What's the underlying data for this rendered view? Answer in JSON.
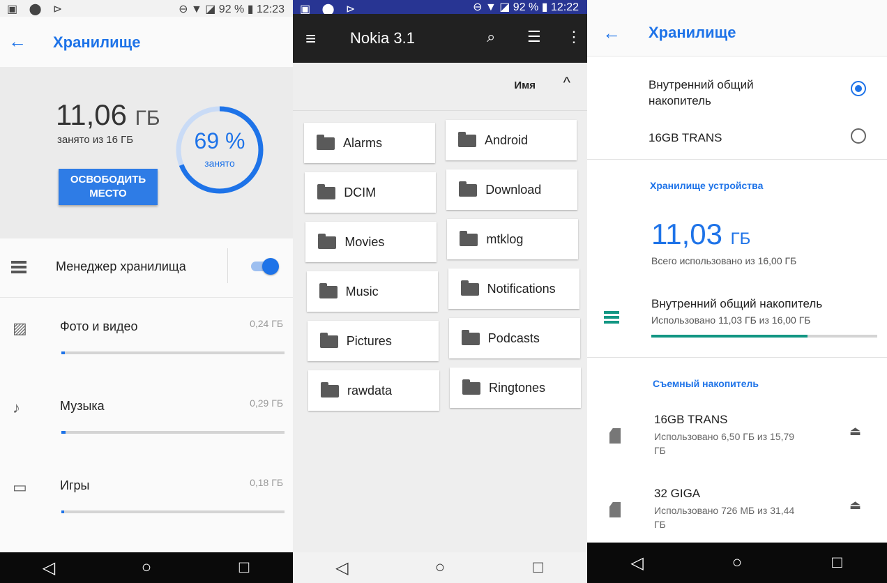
{
  "screen1": {
    "status": {
      "left_icons": "▣ ⬤ ⊳",
      "right": "⊖ ▼ ◪ 92 % ▮ 12:23"
    },
    "title": "Хранилище",
    "used_value": "11,06",
    "used_unit": "ГБ",
    "used_of": "занято из 16 ГБ",
    "free_button": "ОСВОБОДИТЬ МЕСТО",
    "percent_label": "69 %",
    "percent_value": 69,
    "percent_caption": "занято",
    "manager_label": "Менеджер хранилища",
    "manager_enabled": true,
    "categories": [
      {
        "label": "Фото и видео",
        "size": "0,24 ГБ",
        "fraction": 0.015,
        "icon": "photo-icon"
      },
      {
        "label": "Музыка",
        "size": "0,29 ГБ",
        "fraction": 0.018,
        "icon": "music-note-icon"
      },
      {
        "label": "Игры",
        "size": "0,18 ГБ",
        "fraction": 0.011,
        "icon": "gamepad-icon"
      }
    ]
  },
  "screen2": {
    "status": {
      "left_icons": "▣ ⬤ ⊳",
      "right": "⊖ ▼ ◪ 92 % ▮ 12:22"
    },
    "title": "Nokia 3.1",
    "sort_label": "Имя",
    "folders": [
      "Alarms",
      "Android",
      "DCIM",
      "Download",
      "Movies",
      "mtklog",
      "Music",
      "Notifications",
      "Pictures",
      "Podcasts",
      "rawdata",
      "Ringtones"
    ]
  },
  "screen3": {
    "title": "Хранилище",
    "options": [
      {
        "label": "Внутренний общий накопитель",
        "selected": true
      },
      {
        "label": "16GB TRANS",
        "selected": false
      }
    ],
    "device_section": "Хранилище устройства",
    "device_used_value": "11,03",
    "device_used_unit": "ГБ",
    "device_total": "Всего использовано из 16,00 ГБ",
    "internal_title": "Внутренний общий накопитель",
    "internal_sub": "Использовано 11,03 ГБ из 16,00 ГБ",
    "internal_fraction": 0.69,
    "removable_section": "Съемный накопитель",
    "removable": [
      {
        "title": "16GB TRANS",
        "sub": "Использовано 6,50 ГБ из 15,79 ГБ"
      },
      {
        "title": "32 GIGA",
        "sub": "Использовано 726 МБ из 31,44 ГБ"
      }
    ]
  },
  "colors": {
    "accent": "#1e73e8",
    "teal": "#129683",
    "dark_bar": "#212121"
  }
}
